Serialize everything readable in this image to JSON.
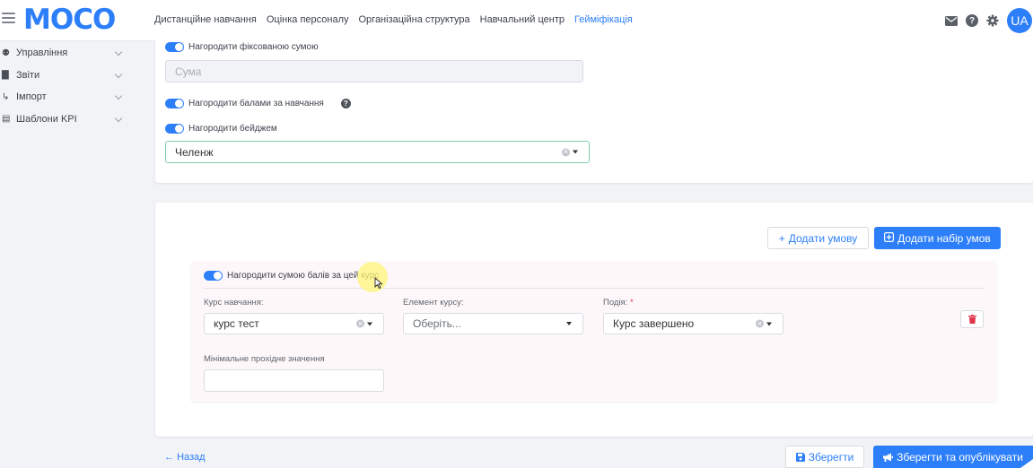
{
  "header": {
    "logo": "MOCO",
    "nav": [
      {
        "label": "Дистанційне навчання",
        "active": false
      },
      {
        "label": "Оцінка персоналу",
        "active": false
      },
      {
        "label": "Організаційна структура",
        "active": false
      },
      {
        "label": "Навчальний центр",
        "active": false
      },
      {
        "label": "Гейміфікація",
        "active": true
      }
    ],
    "avatar": "UA",
    "help_glyph": "?"
  },
  "sidebar": {
    "items": [
      {
        "label": "Управління",
        "icon": "binoculars-icon"
      },
      {
        "label": "Звіти",
        "icon": "bar-chart-icon"
      },
      {
        "label": "Імпорт",
        "icon": "import-icon"
      },
      {
        "label": "Шаблони KPI",
        "icon": "template-icon"
      }
    ]
  },
  "reward": {
    "fixed_sum_label": "Нагородити фіксованою сумою",
    "sum_placeholder": "Сума",
    "points_label": "Нагородити балами за навчання",
    "badge_label": "Нагородити бейджем",
    "badge_value": "Челенж"
  },
  "conditions": {
    "add_condition": "Додати умову",
    "add_condition_set": "Додати набір умов",
    "toggle_label": "Нагородити сумою балів за цей курс",
    "course_label": "Курс навчання:",
    "course_value": "курс тест",
    "element_label": "Елемент курсу:",
    "element_placeholder": "Оберіть...",
    "event_label": "Подія:",
    "event_value": "Курс завершено",
    "min_value_label": "Мінімальне прохідне значення",
    "required_mark": "*"
  },
  "footer": {
    "back": "Назад",
    "save": "Зберегти",
    "save_publish": "Зберегти та опублікувати"
  },
  "colors": {
    "accent": "#2d7ff9",
    "danger": "#e0344a",
    "badge_border": "#7fd0a6"
  }
}
